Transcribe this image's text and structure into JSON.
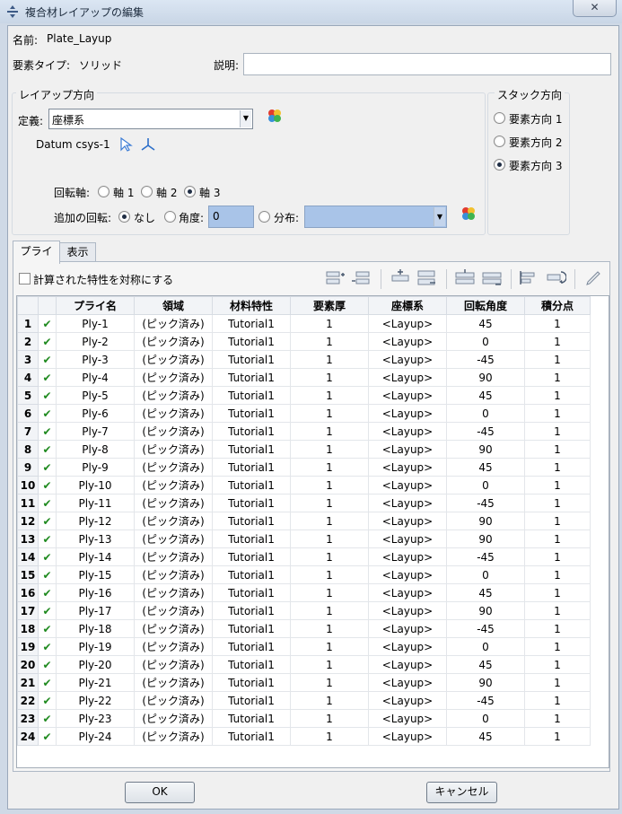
{
  "window": {
    "title": "複合材レイアップの編集",
    "close_glyph": "✕"
  },
  "header": {
    "name_label": "名前:",
    "name_value": "Plate_Layup",
    "element_type_label": "要素タイプ:",
    "element_type_value": "ソリッド",
    "description_label": "説明:",
    "description_value": ""
  },
  "layup_orientation": {
    "group_title": "レイアップ方向",
    "definition_label": "定義:",
    "definition_value": "座標系",
    "csys_name": "Datum csys-1",
    "rotation_axis_label": "回転軸:",
    "axes": [
      {
        "label": "軸 1",
        "selected": false
      },
      {
        "label": "軸 2",
        "selected": false
      },
      {
        "label": "軸 3",
        "selected": true
      }
    ],
    "additional_rotation_label": "追加の回転:",
    "rot_none_label": "なし",
    "rot_angle_label": "角度:",
    "rot_angle_value": "0",
    "rot_dist_label": "分布:",
    "rot_dist_value": ""
  },
  "stack_direction": {
    "group_title": "スタック方向",
    "options": [
      {
        "label": "要素方向 1",
        "selected": false
      },
      {
        "label": "要素方向 2",
        "selected": false
      },
      {
        "label": "要素方向 3",
        "selected": true
      }
    ]
  },
  "tabs": [
    {
      "label": "プライ",
      "active": true
    },
    {
      "label": "表示",
      "active": false
    }
  ],
  "plies_panel": {
    "symmetric_label": "計算された特性を対称にする",
    "columns": [
      "",
      "",
      "プライ名",
      "領域",
      "材料特性",
      "要素厚",
      "座標系",
      "回転角度",
      "積分点"
    ],
    "rows": [
      [
        "1",
        "✔",
        "Ply-1",
        "(ピック済み)",
        "Tutorial1",
        "1",
        "<Layup>",
        "45",
        "1"
      ],
      [
        "2",
        "✔",
        "Ply-2",
        "(ピック済み)",
        "Tutorial1",
        "1",
        "<Layup>",
        "0",
        "1"
      ],
      [
        "3",
        "✔",
        "Ply-3",
        "(ピック済み)",
        "Tutorial1",
        "1",
        "<Layup>",
        "-45",
        "1"
      ],
      [
        "4",
        "✔",
        "Ply-4",
        "(ピック済み)",
        "Tutorial1",
        "1",
        "<Layup>",
        "90",
        "1"
      ],
      [
        "5",
        "✔",
        "Ply-5",
        "(ピック済み)",
        "Tutorial1",
        "1",
        "<Layup>",
        "45",
        "1"
      ],
      [
        "6",
        "✔",
        "Ply-6",
        "(ピック済み)",
        "Tutorial1",
        "1",
        "<Layup>",
        "0",
        "1"
      ],
      [
        "7",
        "✔",
        "Ply-7",
        "(ピック済み)",
        "Tutorial1",
        "1",
        "<Layup>",
        "-45",
        "1"
      ],
      [
        "8",
        "✔",
        "Ply-8",
        "(ピック済み)",
        "Tutorial1",
        "1",
        "<Layup>",
        "90",
        "1"
      ],
      [
        "9",
        "✔",
        "Ply-9",
        "(ピック済み)",
        "Tutorial1",
        "1",
        "<Layup>",
        "45",
        "1"
      ],
      [
        "10",
        "✔",
        "Ply-10",
        "(ピック済み)",
        "Tutorial1",
        "1",
        "<Layup>",
        "0",
        "1"
      ],
      [
        "11",
        "✔",
        "Ply-11",
        "(ピック済み)",
        "Tutorial1",
        "1",
        "<Layup>",
        "-45",
        "1"
      ],
      [
        "12",
        "✔",
        "Ply-12",
        "(ピック済み)",
        "Tutorial1",
        "1",
        "<Layup>",
        "90",
        "1"
      ],
      [
        "13",
        "✔",
        "Ply-13",
        "(ピック済み)",
        "Tutorial1",
        "1",
        "<Layup>",
        "90",
        "1"
      ],
      [
        "14",
        "✔",
        "Ply-14",
        "(ピック済み)",
        "Tutorial1",
        "1",
        "<Layup>",
        "-45",
        "1"
      ],
      [
        "15",
        "✔",
        "Ply-15",
        "(ピック済み)",
        "Tutorial1",
        "1",
        "<Layup>",
        "0",
        "1"
      ],
      [
        "16",
        "✔",
        "Ply-16",
        "(ピック済み)",
        "Tutorial1",
        "1",
        "<Layup>",
        "45",
        "1"
      ],
      [
        "17",
        "✔",
        "Ply-17",
        "(ピック済み)",
        "Tutorial1",
        "1",
        "<Layup>",
        "90",
        "1"
      ],
      [
        "18",
        "✔",
        "Ply-18",
        "(ピック済み)",
        "Tutorial1",
        "1",
        "<Layup>",
        "-45",
        "1"
      ],
      [
        "19",
        "✔",
        "Ply-19",
        "(ピック済み)",
        "Tutorial1",
        "1",
        "<Layup>",
        "0",
        "1"
      ],
      [
        "20",
        "✔",
        "Ply-20",
        "(ピック済み)",
        "Tutorial1",
        "1",
        "<Layup>",
        "45",
        "1"
      ],
      [
        "21",
        "✔",
        "Ply-21",
        "(ピック済み)",
        "Tutorial1",
        "1",
        "<Layup>",
        "90",
        "1"
      ],
      [
        "22",
        "✔",
        "Ply-22",
        "(ピック済み)",
        "Tutorial1",
        "1",
        "<Layup>",
        "-45",
        "1"
      ],
      [
        "23",
        "✔",
        "Ply-23",
        "(ピック済み)",
        "Tutorial1",
        "1",
        "<Layup>",
        "0",
        "1"
      ],
      [
        "24",
        "✔",
        "Ply-24",
        "(ピック済み)",
        "Tutorial1",
        "1",
        "<Layup>",
        "45",
        "1"
      ]
    ]
  },
  "footer": {
    "ok_label": "OK",
    "cancel_label": "キャンセル"
  },
  "colors": {
    "check": "#1f8a1f",
    "rotation_field_bg": "#a9c4e8",
    "title_bar": "#cfdcec"
  }
}
